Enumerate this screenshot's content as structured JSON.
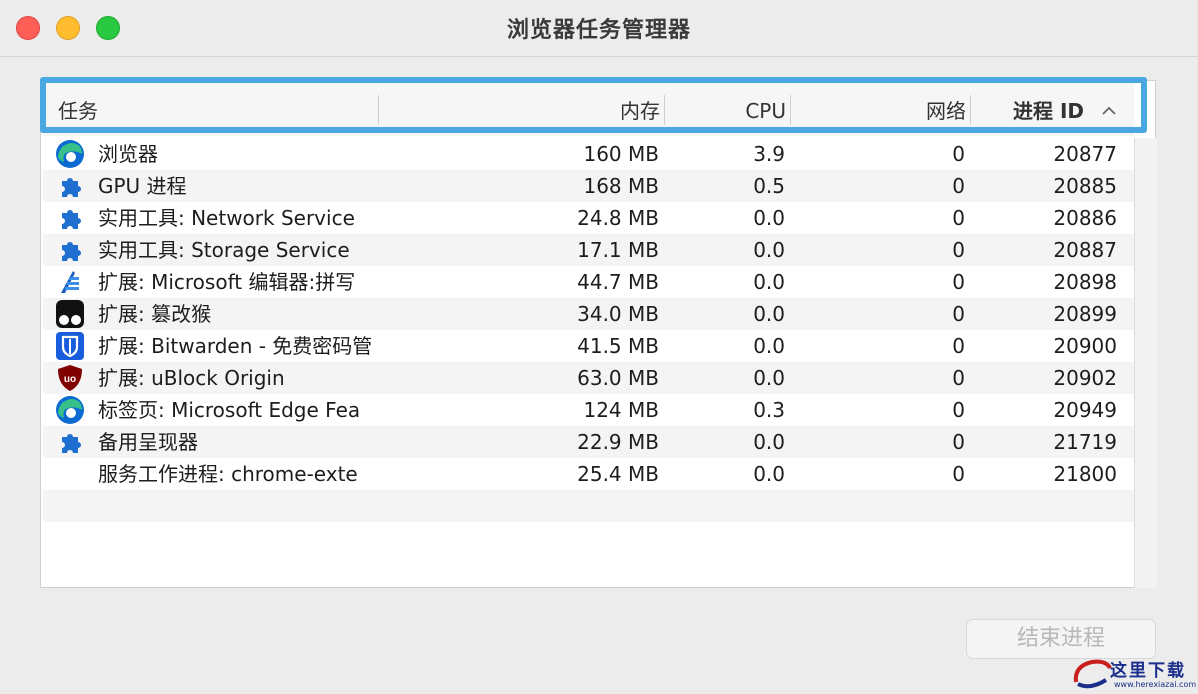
{
  "window": {
    "title": "浏览器任务管理器"
  },
  "table": {
    "headers": {
      "task": "任务",
      "memory": "内存",
      "cpu": "CPU",
      "network": "网络",
      "pid": "进程 ID",
      "sort_indicator": "^"
    },
    "sort_column": "pid",
    "rows": [
      {
        "icon": "edge-icon",
        "name": "浏览器",
        "memory": "160 MB",
        "cpu": "3.9",
        "network": "0",
        "pid": "20877"
      },
      {
        "icon": "puzzle-icon",
        "name": "GPU 进程",
        "memory": "168 MB",
        "cpu": "0.5",
        "network": "0",
        "pid": "20885"
      },
      {
        "icon": "puzzle-icon",
        "name": "实用工具: Network Service",
        "memory": "24.8 MB",
        "cpu": "0.0",
        "network": "0",
        "pid": "20886"
      },
      {
        "icon": "puzzle-icon",
        "name": "实用工具: Storage Service",
        "memory": "17.1 MB",
        "cpu": "0.0",
        "network": "0",
        "pid": "20887"
      },
      {
        "icon": "editor-icon",
        "name": "扩展: Microsoft 编辑器:拼写",
        "memory": "44.7 MB",
        "cpu": "0.0",
        "network": "0",
        "pid": "20898"
      },
      {
        "icon": "tampermonkey-icon",
        "name": "扩展: 篡改猴",
        "memory": "34.0 MB",
        "cpu": "0.0",
        "network": "0",
        "pid": "20899"
      },
      {
        "icon": "bitwarden-icon",
        "name": "扩展: Bitwarden - 免费密码管",
        "memory": "41.5 MB",
        "cpu": "0.0",
        "network": "0",
        "pid": "20900"
      },
      {
        "icon": "ublock-icon",
        "name": "扩展: uBlock Origin",
        "memory": "63.0 MB",
        "cpu": "0.0",
        "network": "0",
        "pid": "20902"
      },
      {
        "icon": "edge-icon",
        "name": "标签页: Microsoft Edge Fea",
        "memory": "124 MB",
        "cpu": "0.3",
        "network": "0",
        "pid": "20949"
      },
      {
        "icon": "puzzle-icon",
        "name": "备用呈现器",
        "memory": "22.9 MB",
        "cpu": "0.0",
        "network": "0",
        "pid": "21719"
      },
      {
        "icon": "",
        "name": "服务工作进程: chrome-exte",
        "memory": "25.4 MB",
        "cpu": "0.0",
        "network": "0",
        "pid": "21800"
      }
    ]
  },
  "footer": {
    "end_process_label": "结束进程",
    "end_process_enabled": false
  },
  "watermark": {
    "text": "这里下载",
    "subtext": "www.herexiazai.com"
  },
  "colors": {
    "focus_ring": "#4aa8e0",
    "puzzle": "#1f6fd0",
    "edge_blue": "#0c6bd0",
    "edge_green": "#38c08a",
    "ublock_red": "#800000",
    "bitwarden_blue": "#175ddc"
  }
}
